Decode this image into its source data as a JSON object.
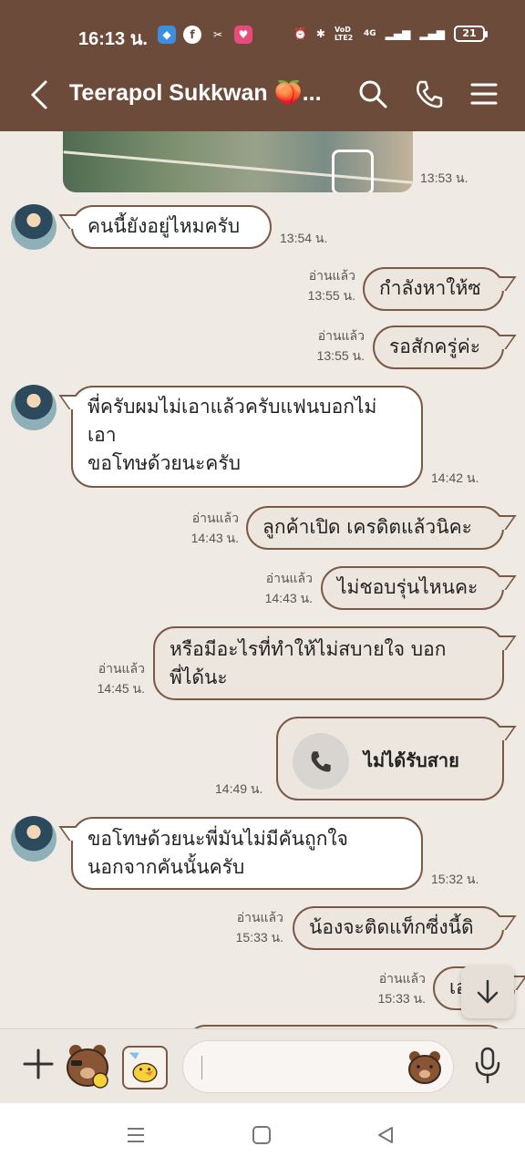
{
  "status_bar": {
    "time": "16:13 น.",
    "network": "4G",
    "volte": "VoD LTE2",
    "battery": "21"
  },
  "header": {
    "title": "Teerapol Sukkwan 🍑...",
    "icons": [
      "back-icon",
      "search-icon",
      "phone-icon",
      "menu-icon"
    ]
  },
  "chat": {
    "photo_time": "13:53 น.",
    "messages": [
      {
        "dir": "in",
        "text": "คนนี้ยังอยู่ไหมครับ",
        "time": "13:54 น."
      },
      {
        "dir": "out",
        "text": "กำลังหาให้ซ",
        "read": "อ่านแล้ว",
        "time": "13:55 น."
      },
      {
        "dir": "out",
        "text": "รอสักครู่ค่ะ",
        "read": "อ่านแล้ว",
        "time": "13:55 น."
      },
      {
        "dir": "in",
        "line1": "พี่ครับผมไม่เอาแล้วครับแฟนบอกไม่",
        "line2": "เอา",
        "line3": "ขอโทษด้วยนะครับ",
        "time": "14:42 น."
      },
      {
        "dir": "out",
        "text": "ลูกค้าเปิด เครดิตแล้วนิคะ",
        "read": "อ่านแล้ว",
        "time": "14:43 น."
      },
      {
        "dir": "out",
        "text": "ไม่ชอบรุ่นไหนคะ",
        "read": "อ่านแล้ว",
        "time": "14:43 น."
      },
      {
        "dir": "out",
        "line1": "หรือมีอะไรที่ทำให้ไม่สบายใจ บอก",
        "line2": "พี่ได้นะ",
        "read": "อ่านแล้ว",
        "time": "14:45 น."
      },
      {
        "dir": "out",
        "type": "call",
        "text": "ไม่ได้รับสาย",
        "time": "14:49 น."
      },
      {
        "dir": "in",
        "line1": "ขอโทษด้วยนะพี่มันไม่มีคันถูกใจ",
        "line2": "นอกจากคันนั้นครับ",
        "time": "15:32 น."
      },
      {
        "dir": "out",
        "text": "น้องจะติดแท็กซี่งนี้ดิ",
        "read": "อ่านแล้ว",
        "time": "15:33 น."
      },
      {
        "dir": "out",
        "text": "เอ",
        "read": "อ่านแล้ว",
        "time": "15:33 น."
      }
    ]
  },
  "colors": {
    "header_bg": "#6d4b3b",
    "chat_bg": "#efeae4",
    "bubble_border": "#7a5a47",
    "bubble_out": "#ede6df"
  }
}
